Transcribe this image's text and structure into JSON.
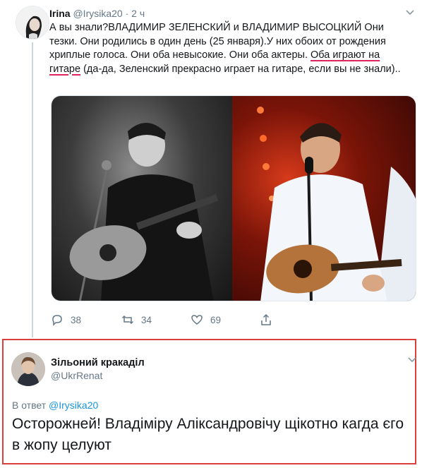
{
  "tweet": {
    "author_name": "Irina",
    "author_handle": "@Irysika20",
    "separator": "·",
    "time": "2 ч",
    "text_before": "А вы знали?ВЛАДИМИР ЗЕЛЕНСКИЙ и ВЛАДИМИР ВЫСОЦКИЙ Они тезки. Они родились в один день (25 января).У них обоих от рождения хриплые голоса. Они оба невысокие. Они оба актеры. ",
    "text_highlight": "Оба играют на гитаре",
    "text_after": " (да-да, Зеленский прекрасно играет на гитаре, если вы не знали)..",
    "media_icons": [
      "black-and-white-photo-guitarist",
      "stage-photo-guitarist"
    ],
    "actions": {
      "reply_count": "38",
      "retweet_count": "34",
      "like_count": "69",
      "share_count": ""
    }
  },
  "reply": {
    "author_name": "Зільоний кракаділ",
    "author_handle": "@UkrRenat",
    "in_reply_prefix": "В ответ",
    "in_reply_handle": "@Irysika20",
    "text": "Осторожней! Владіміру Аліксандровічу щікотно кагда єго в жопу целуют"
  },
  "colors": {
    "link": "#1b95e0",
    "muted": "#657786",
    "highlight_border": "#d9403a",
    "underline": "#e0245e"
  }
}
